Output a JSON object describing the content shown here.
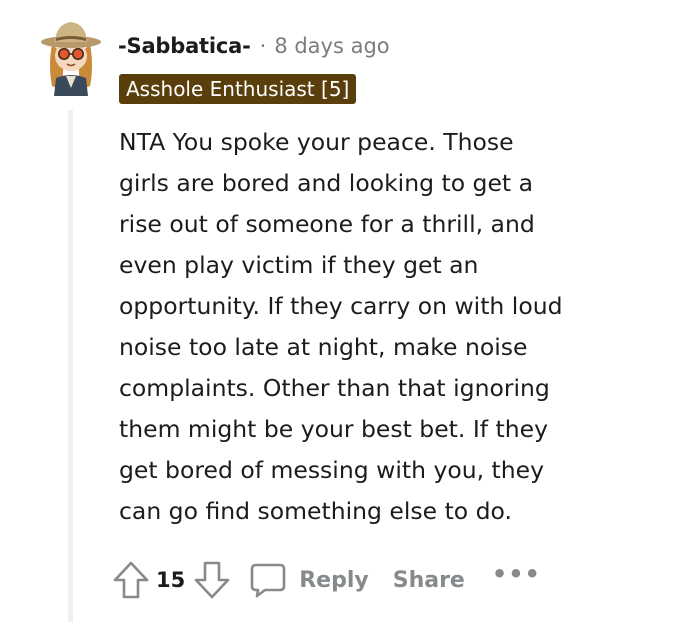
{
  "comment": {
    "username": "-Sabbatica-",
    "separator": "·",
    "timestamp": "8 days ago",
    "flair": "Asshole Enthusiast [5]",
    "body_lines": [
      "NTA You spoke your peace. Those",
      "girls are bored and looking to get a",
      "rise out of someone for a thrill, and",
      "even play victim if they get an",
      "opportunity. If they carry on with loud",
      "noise too late at night, make noise",
      "complaints. Other than that ignoring",
      "them might be your best bet. If they",
      "get bored of messing with you, they",
      "can go find something else to do."
    ],
    "avatar_icon": "snoo-avatar-cowboy-hat-sunglasses"
  },
  "actions": {
    "upvote_icon": "upvote-arrow-icon",
    "vote_count": "15",
    "downvote_icon": "downvote-arrow-icon",
    "reply_icon": "speech-bubble-icon",
    "reply_label": "Reply",
    "share_label": "Share",
    "more_label": "•••"
  },
  "colors": {
    "flair_background": "#5a3f0c",
    "muted_text": "#7c7c7c",
    "action_gray": "#878a8c",
    "thread_line": "#edeff1"
  }
}
